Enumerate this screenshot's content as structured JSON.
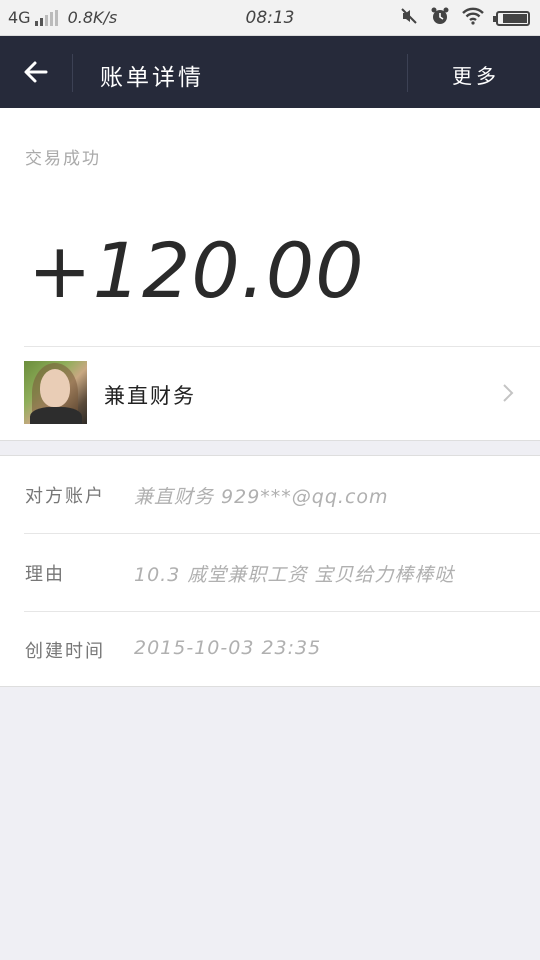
{
  "status_bar": {
    "network": "4G",
    "speed": "0.8K/s",
    "time": "08:13",
    "icons": [
      "mute-icon",
      "alarm-icon",
      "wifi-icon",
      "battery-icon"
    ]
  },
  "nav": {
    "back_icon": "arrow-left-icon",
    "title": "账单详情",
    "more_label": "更多"
  },
  "transaction": {
    "status": "交易成功",
    "amount": "+120.00",
    "payer_name": "兼直财务"
  },
  "details": [
    {
      "label": "对方账户",
      "value": "兼直财务 929***@qq.com"
    },
    {
      "label": "理由",
      "value": "10.3 戚堂兼职工资 宝贝给力棒棒哒"
    },
    {
      "label": "创建时间",
      "value": "2015-10-03 23:35"
    }
  ],
  "colors": {
    "nav_background": "#262a3a",
    "page_background": "#efeff4",
    "card_background": "#ffffff"
  }
}
